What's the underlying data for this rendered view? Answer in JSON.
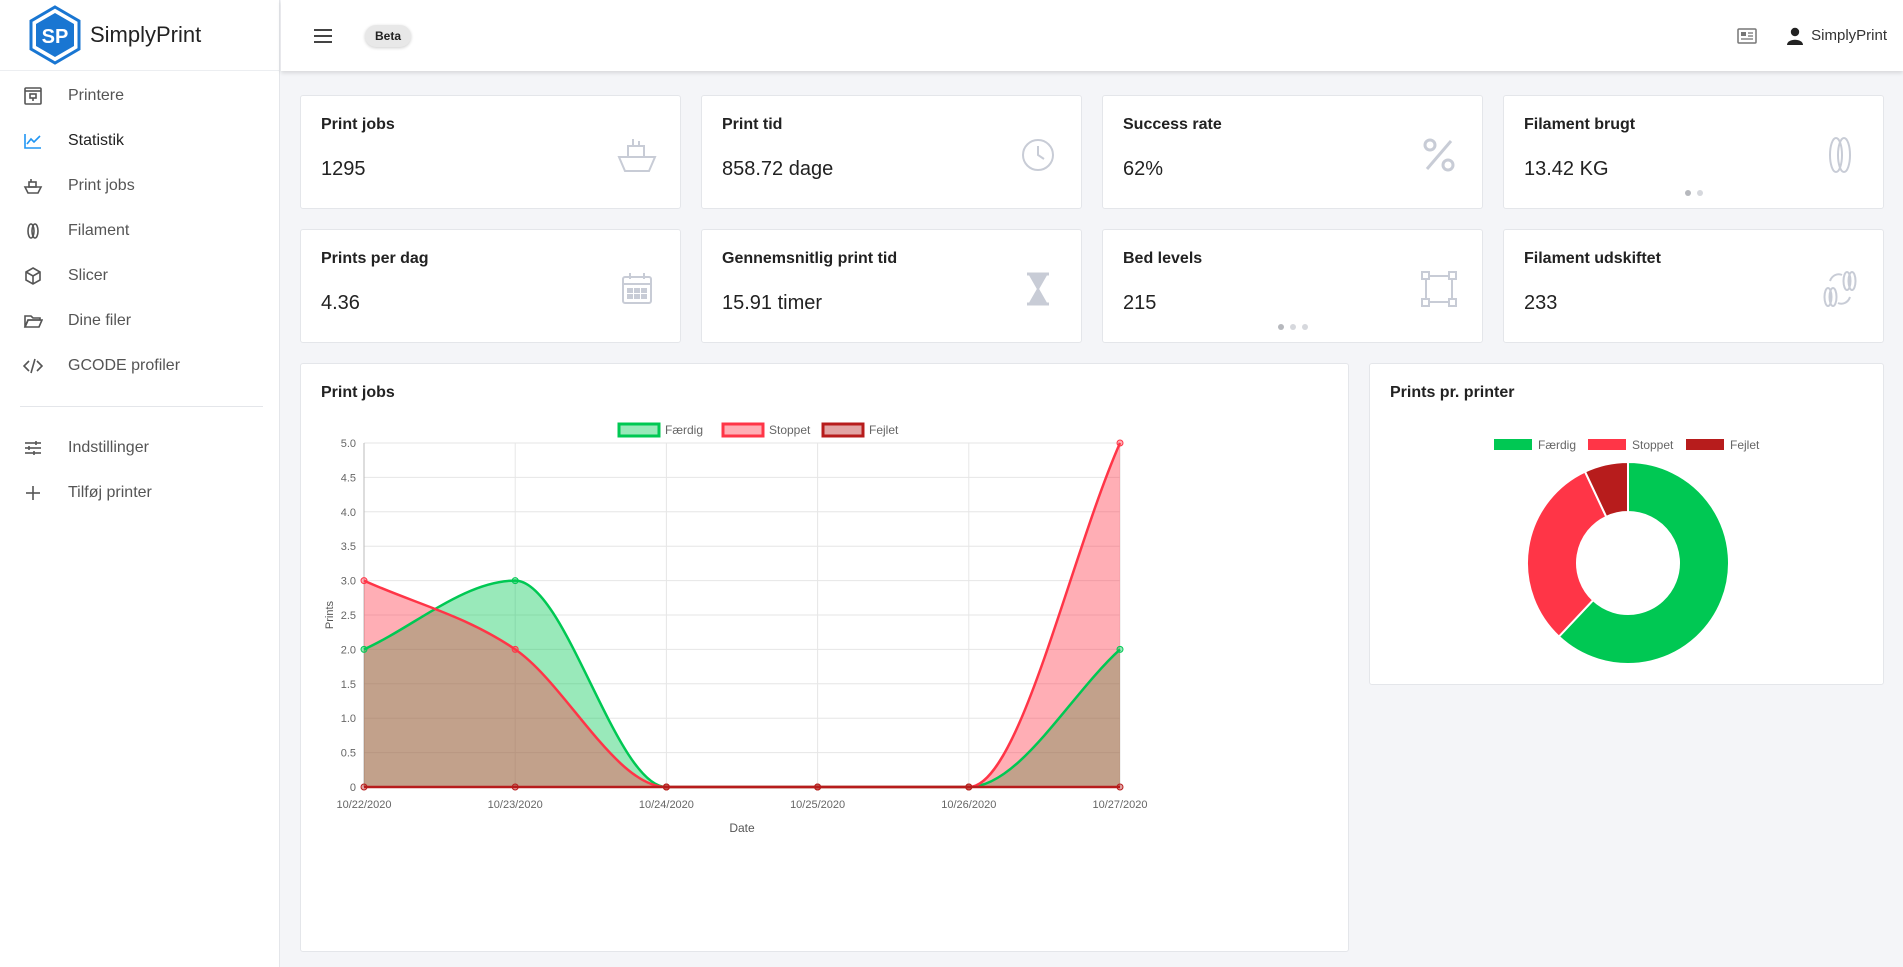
{
  "brand": {
    "name": "SimplyPrint",
    "logo_text": "SP"
  },
  "sidebar": {
    "items": [
      {
        "label": "Printere",
        "icon": "printer-icon",
        "active": false
      },
      {
        "label": "Statistik",
        "icon": "chart-line-icon",
        "active": true
      },
      {
        "label": "Print jobs",
        "icon": "boat-icon",
        "active": false
      },
      {
        "label": "Filament",
        "icon": "filament-icon",
        "active": false
      },
      {
        "label": "Slicer",
        "icon": "cube-icon",
        "active": false
      },
      {
        "label": "Dine filer",
        "icon": "folder-open-icon",
        "active": false
      },
      {
        "label": "GCODE profiler",
        "icon": "code-icon",
        "active": false
      }
    ],
    "bottom_items": [
      {
        "label": "Indstillinger",
        "icon": "sliders-icon"
      },
      {
        "label": "Tilføj printer",
        "icon": "plus-icon"
      }
    ]
  },
  "topbar": {
    "badge": "Beta",
    "user": "SimplyPrint"
  },
  "stats": [
    {
      "title": "Print jobs",
      "value": "1295",
      "icon": "boat-icon"
    },
    {
      "title": "Print tid",
      "value": "858.72 dage",
      "icon": "clock-icon"
    },
    {
      "title": "Success rate",
      "value": "62%",
      "icon": "percent-icon"
    },
    {
      "title": "Filament brugt",
      "value": "13.42 KG",
      "icon": "filament-icon",
      "dots": 2
    },
    {
      "title": "Prints per dag",
      "value": "4.36",
      "icon": "calendar-icon"
    },
    {
      "title": "Gennemsnitlig print tid",
      "value": "15.91 timer",
      "icon": "hourglass-icon"
    },
    {
      "title": "Bed levels",
      "value": "215",
      "icon": "bed-level-icon",
      "dots": 3
    },
    {
      "title": "Filament udskiftet",
      "value": "233",
      "icon": "filament-swap-icon"
    }
  ],
  "colors": {
    "done": "#00c853",
    "stopped": "#ff3547",
    "failed": "#b71c1c",
    "accent": "#2196f3"
  },
  "chart_data": [
    {
      "type": "area",
      "title": "Print jobs",
      "xlabel": "Date",
      "ylabel": "Prints",
      "x": [
        "10/22/2020",
        "10/23/2020",
        "10/24/2020",
        "10/25/2020",
        "10/26/2020",
        "10/27/2020"
      ],
      "ylim": [
        0,
        5
      ],
      "yticks": [
        "0",
        "0.5",
        "1.0",
        "1.5",
        "2.0",
        "2.5",
        "3.0",
        "3.5",
        "4.0",
        "4.5",
        "5.0"
      ],
      "grid": true,
      "legend": "top-center",
      "series": [
        {
          "name": "Færdig",
          "values": [
            2,
            3,
            0,
            0,
            0,
            2
          ]
        },
        {
          "name": "Stoppet",
          "values": [
            3,
            2,
            0,
            0,
            0,
            5
          ]
        },
        {
          "name": "Fejlet",
          "values": [
            0,
            0,
            0,
            0,
            0,
            0
          ]
        }
      ]
    },
    {
      "type": "pie",
      "title": "Prints pr. printer",
      "legend": "top-center",
      "categories": [
        "Færdig",
        "Stoppet",
        "Fejlet"
      ],
      "values": [
        62,
        31,
        7
      ]
    }
  ]
}
